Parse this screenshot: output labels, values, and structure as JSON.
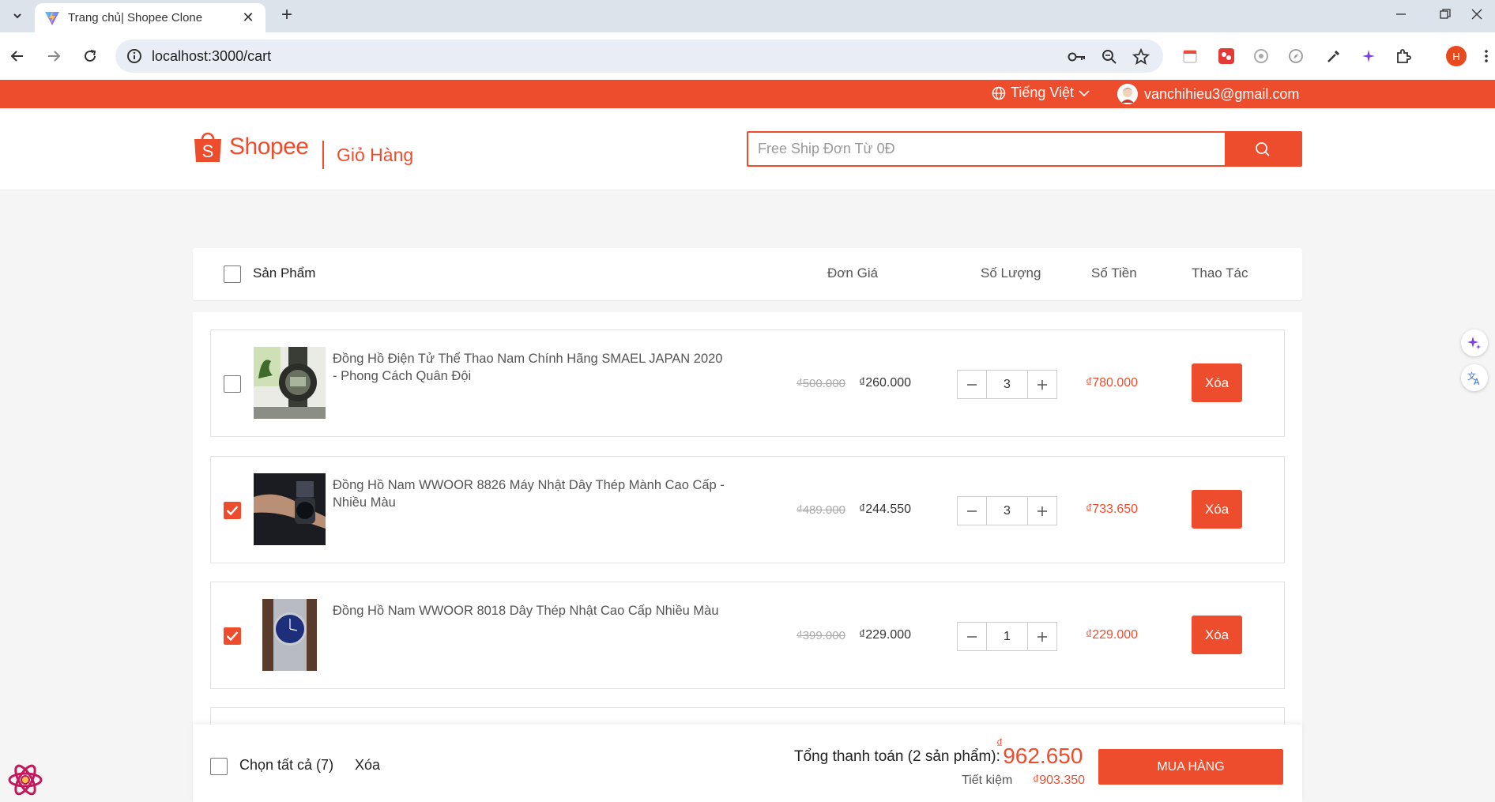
{
  "browser": {
    "tab_title": "Trang chủ| Shopee Clone",
    "url": "localhost:3000/cart",
    "profile_initial": "H"
  },
  "topbar": {
    "language": "Tiếng Việt",
    "user_email": "vanchihieu3@gmail.com"
  },
  "header": {
    "logo_text": "Shopee",
    "page_title": "Giỏ Hàng",
    "search_placeholder": "Free Ship Đơn Từ 0Đ"
  },
  "columns": {
    "product": "Sản Phẩm",
    "unit_price": "Đơn Giá",
    "quantity": "Số Lượng",
    "amount": "Số Tiền",
    "actions": "Thao Tác"
  },
  "items": [
    {
      "name": "Đồng Hồ Điện Tử Thể Thao Nam Chính Hãng SMAEL JAPAN 2020 - Phong Cách Quân Đội",
      "old_price": "₫500.000",
      "price": "₫260.000",
      "quantity": "3",
      "total": "₫780.000",
      "delete_label": "Xóa",
      "checked": false
    },
    {
      "name": "Đồng Hồ Nam WWOOR 8826 Máy Nhật Dây Thép Mành Cao Cấp - Nhiều Màu",
      "old_price": "₫489.000",
      "price": "₫244.550",
      "quantity": "3",
      "total": "₫733.650",
      "delete_label": "Xóa",
      "checked": true
    },
    {
      "name": "Đồng Hồ Nam WWOOR 8018 Dây Thép Nhật Cao Cấp Nhiều Màu",
      "old_price": "₫399.000",
      "price": "₫229.000",
      "quantity": "1",
      "total": "₫229.000",
      "delete_label": "Xóa",
      "checked": true
    }
  ],
  "footer": {
    "select_all": "Chọn tất cả (7)",
    "delete": "Xóa",
    "total_label": "Tổng thanh toán (2 sản phẩm):",
    "total_currency": "₫",
    "total_value": "962.650",
    "saving_label": "Tiết kiệm",
    "saving_value": "₫903.350",
    "buy_label": "MUA HÀNG"
  },
  "colors": {
    "brand": "#ee4d2d"
  }
}
